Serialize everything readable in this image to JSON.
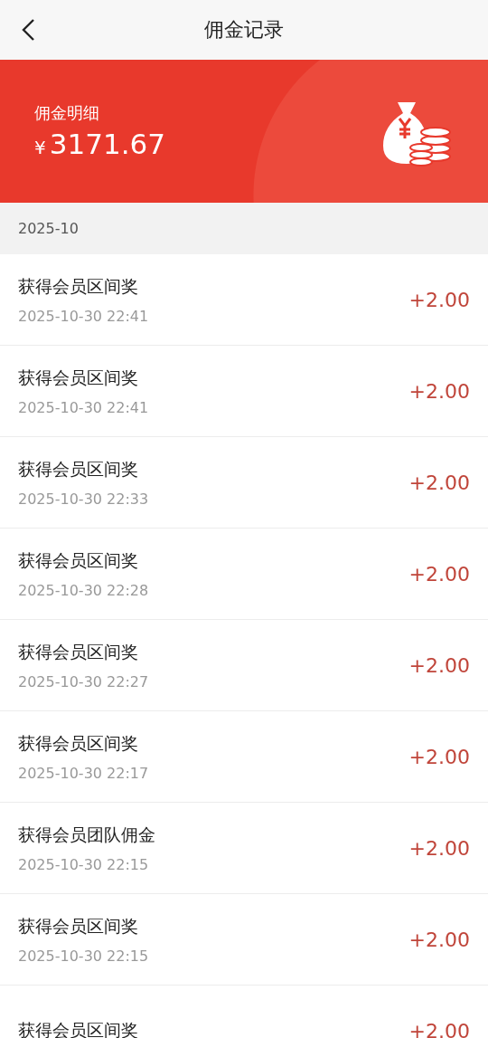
{
  "nav": {
    "title": "佣金记录"
  },
  "banner": {
    "label": "佣金明细",
    "currency": "¥",
    "amount": "3171.67"
  },
  "month": "2025-10",
  "records": [
    {
      "title": "获得会员区间奖",
      "time": "2025-10-30 22:41",
      "amount": "+2.00"
    },
    {
      "title": "获得会员区间奖",
      "time": "2025-10-30 22:41",
      "amount": "+2.00"
    },
    {
      "title": "获得会员区间奖",
      "time": "2025-10-30 22:33",
      "amount": "+2.00"
    },
    {
      "title": "获得会员区间奖",
      "time": "2025-10-30 22:28",
      "amount": "+2.00"
    },
    {
      "title": "获得会员区间奖",
      "time": "2025-10-30 22:27",
      "amount": "+2.00"
    },
    {
      "title": "获得会员区间奖",
      "time": "2025-10-30 22:17",
      "amount": "+2.00"
    },
    {
      "title": "获得会员团队佣金",
      "time": "2025-10-30 22:15",
      "amount": "+2.00"
    },
    {
      "title": "获得会员区间奖",
      "time": "2025-10-30 22:15",
      "amount": "+2.00"
    },
    {
      "title": "获得会员区间奖",
      "amount": "+2.00"
    }
  ]
}
